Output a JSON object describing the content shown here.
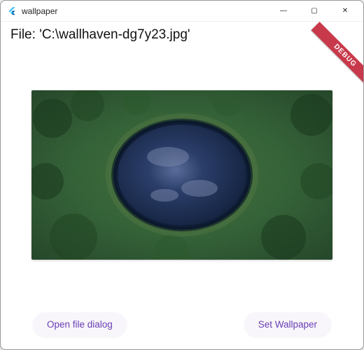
{
  "window": {
    "title": "wallpaper",
    "icon_name": "flutter-icon"
  },
  "controls": {
    "minimize_glyph": "—",
    "maximize_glyph": "▢",
    "close_glyph": "✕"
  },
  "file": {
    "label_prefix": "File: ",
    "path_display": "'C:\\wallhaven-dg7y23.jpg'"
  },
  "buttons": {
    "open_label": "Open file dialog",
    "set_label": "Set Wallpaper"
  },
  "debug": {
    "banner_text": "DEBUG"
  },
  "colors": {
    "accent": "#6a3eb5",
    "debug_banner": "#c83a4b",
    "forest_dark": "#1a3a1e",
    "forest_mid": "#2d5a2f",
    "forest_light": "#4a7a3f",
    "water_dark": "#1a2a4a",
    "water_mid": "#2b3e6a",
    "water_light": "#4a5d8a"
  }
}
